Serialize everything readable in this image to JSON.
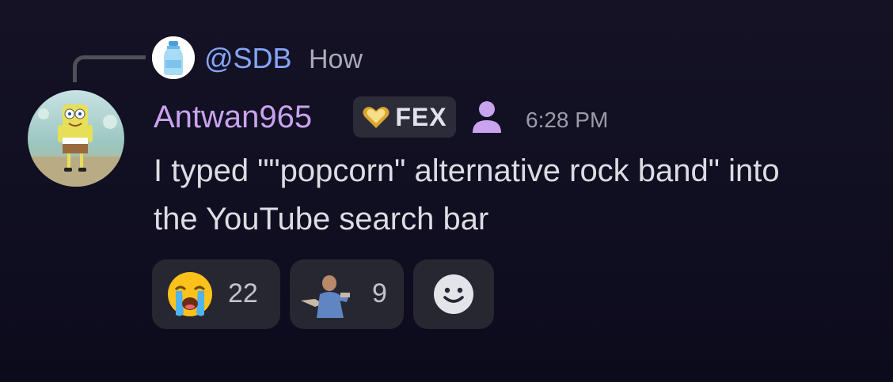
{
  "reply": {
    "username": "@SDB",
    "preview": "How",
    "avatar_icon": "water-bottle-icon"
  },
  "message": {
    "author": "Antwan965",
    "author_color": "#c9a3ee",
    "tag": "FEX",
    "tag_icon": "gold-heart-icon",
    "role_icon": "person-icon",
    "timestamp": "6:28 PM",
    "lines": [
      "I typed \"\"popcorn\" alternative rock band\" into",
      "the YouTube search bar"
    ]
  },
  "reactions": [
    {
      "emoji_name": "loudly-crying-face-icon",
      "count": "22"
    },
    {
      "emoji_name": "custom-emoji-icon",
      "count": "9"
    },
    {
      "emoji_name": "add-reaction-icon"
    }
  ],
  "colors": {
    "background": "#121024",
    "mention": "#84a6f7",
    "reaction_bg": "#272732"
  }
}
